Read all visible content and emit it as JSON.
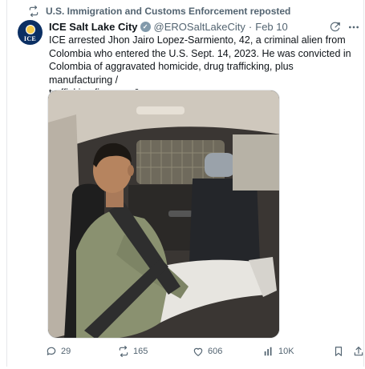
{
  "repost": {
    "label": "U.S. Immigration and Customs Enforcement reposted",
    "icon": "repost-icon"
  },
  "author": {
    "avatar_text": "ICE",
    "display_name": "ICE Salt Lake City",
    "verified": true,
    "handle": "@EROSaltLakeCity",
    "separator": "·",
    "date": "Feb 10"
  },
  "tweet": {
    "lines": [
      "ICE arrested Jhon Jairo Lopez-Sarmiento, 42, a criminal alien from",
      "Colombia who entered the U.S. Sept. 14, 2023. He was convicted in",
      "Colombia of aggravated homicide, drug trafficking, plus manufacturing /",
      "trafficking firearms & ammo."
    ]
  },
  "media": {
    "kind": "photo",
    "subject": "man seated in back seat of a vehicle"
  },
  "actions": {
    "replies": "29",
    "reposts": "165",
    "likes": "606",
    "views": "10K"
  },
  "colors": {
    "text": "#0f1419",
    "muted": "#536471",
    "border": "#e6e8ea",
    "avatar_bg": "#0b2f63"
  }
}
